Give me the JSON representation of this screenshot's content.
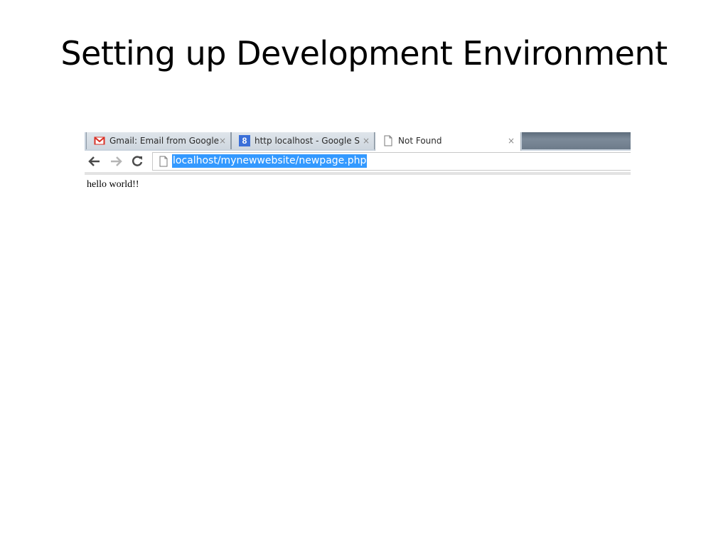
{
  "slide": {
    "title": "Setting up Development Environment"
  },
  "browser": {
    "tabs": [
      {
        "label": "Gmail: Email from Google",
        "close": "×",
        "icon": "gmail-icon",
        "state": "inactive"
      },
      {
        "label": "http localhost - Google Sea",
        "close": "×",
        "icon": "google-search-icon",
        "badge": "8",
        "state": "inactive"
      },
      {
        "label": "Not Found",
        "close": "×",
        "icon": "page-icon",
        "state": "active"
      }
    ],
    "toolbar": {
      "back_icon": "back-arrow-icon",
      "forward_icon": "forward-arrow-icon",
      "reload_icon": "reload-icon"
    },
    "omnibox": {
      "url": "localhost/mynewwebsite/newpage.php",
      "selection_color": "#3399ff"
    },
    "page_content": "hello world!!"
  },
  "colors": {
    "tabstrip": "#c8d2dd",
    "frame": "#6d7b8a",
    "gmail_red": "#d93025",
    "google_blue": "#3a6fd8"
  }
}
